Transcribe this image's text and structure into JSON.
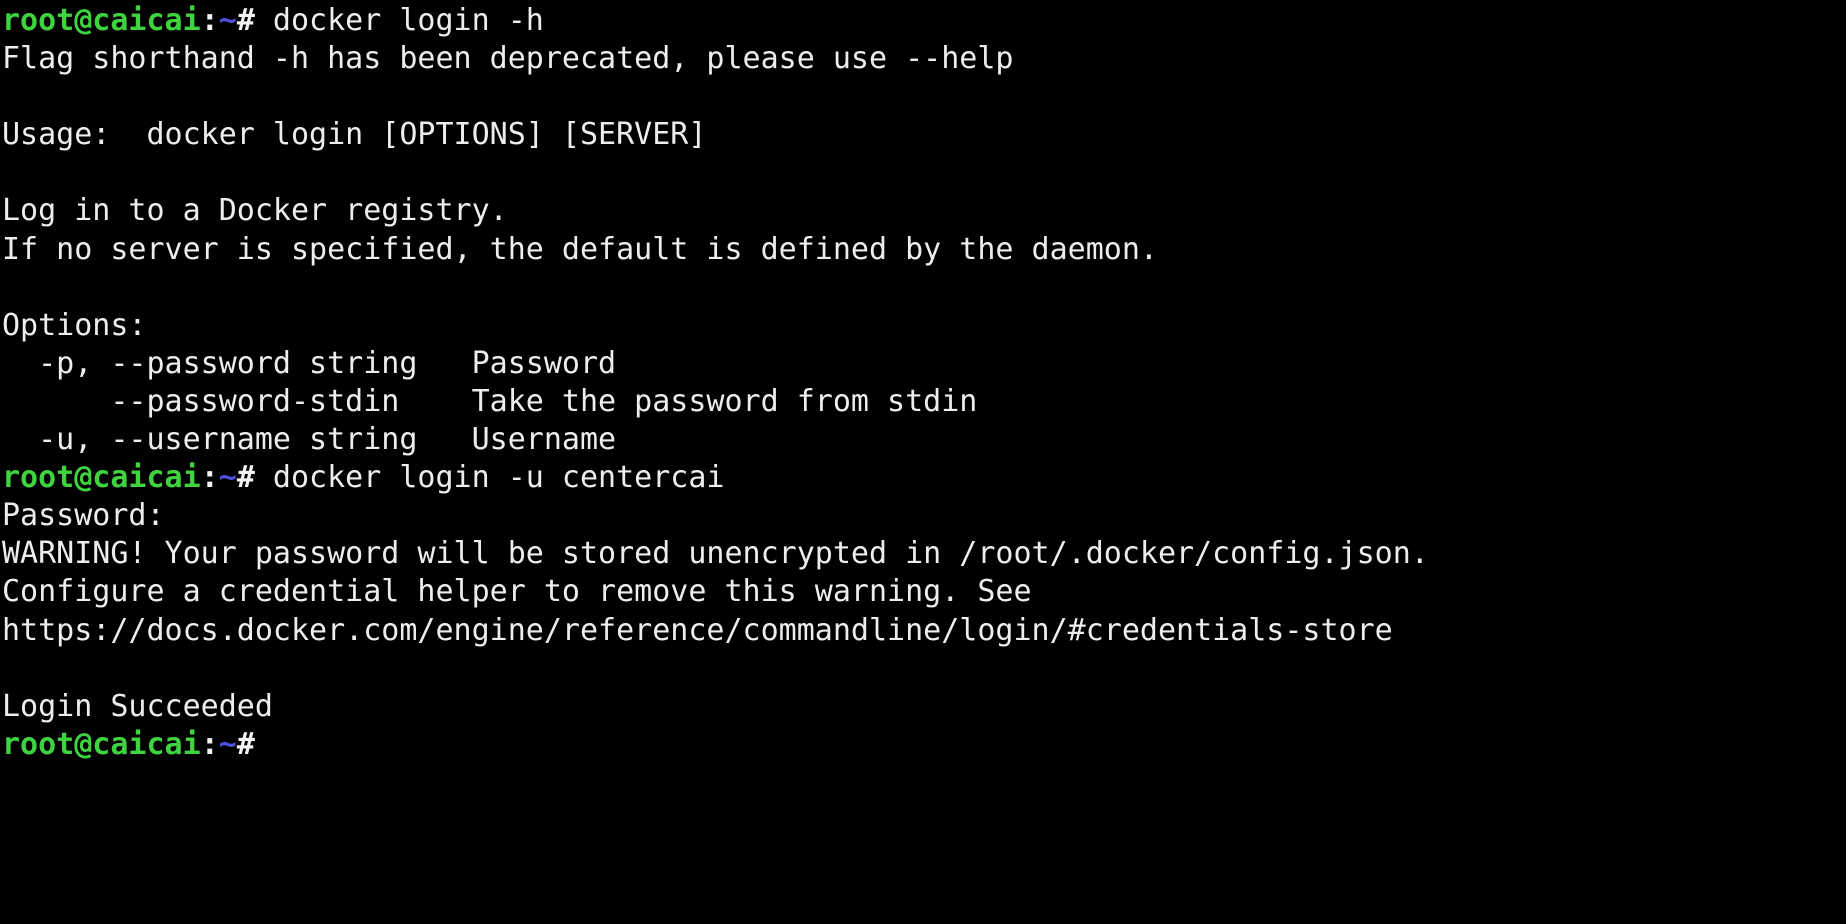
{
  "terminal": {
    "background_color": "#000000",
    "foreground_color": "#ededed",
    "prompt_user_host_color": "#3fd43f",
    "prompt_path_color": "#5050e0",
    "prompt_punct_color": "#f2f2f2",
    "prompt": {
      "user_host": "root@caicai",
      "colon": ":",
      "path": "~",
      "sigil": "#"
    },
    "lines": [
      {
        "type": "prompt",
        "command": " docker login -h"
      },
      {
        "type": "output",
        "text": "Flag shorthand -h has been deprecated, please use --help"
      },
      {
        "type": "blank",
        "text": ""
      },
      {
        "type": "output",
        "text": "Usage:  docker login [OPTIONS] [SERVER]"
      },
      {
        "type": "blank",
        "text": ""
      },
      {
        "type": "output",
        "text": "Log in to a Docker registry."
      },
      {
        "type": "output",
        "text": "If no server is specified, the default is defined by the daemon."
      },
      {
        "type": "blank",
        "text": ""
      },
      {
        "type": "output",
        "text": "Options:"
      },
      {
        "type": "output",
        "text": "  -p, --password string   Password"
      },
      {
        "type": "output",
        "text": "      --password-stdin    Take the password from stdin"
      },
      {
        "type": "output",
        "text": "  -u, --username string   Username"
      },
      {
        "type": "prompt",
        "command": " docker login -u centercai"
      },
      {
        "type": "output",
        "text": "Password:"
      },
      {
        "type": "output",
        "text": "WARNING! Your password will be stored unencrypted in /root/.docker/config.json."
      },
      {
        "type": "output",
        "text": "Configure a credential helper to remove this warning. See"
      },
      {
        "type": "output",
        "text": "https://docs.docker.com/engine/reference/commandline/login/#credentials-store"
      },
      {
        "type": "blank",
        "text": ""
      },
      {
        "type": "output",
        "text": "Login Succeeded"
      },
      {
        "type": "prompt",
        "command": ""
      }
    ]
  }
}
